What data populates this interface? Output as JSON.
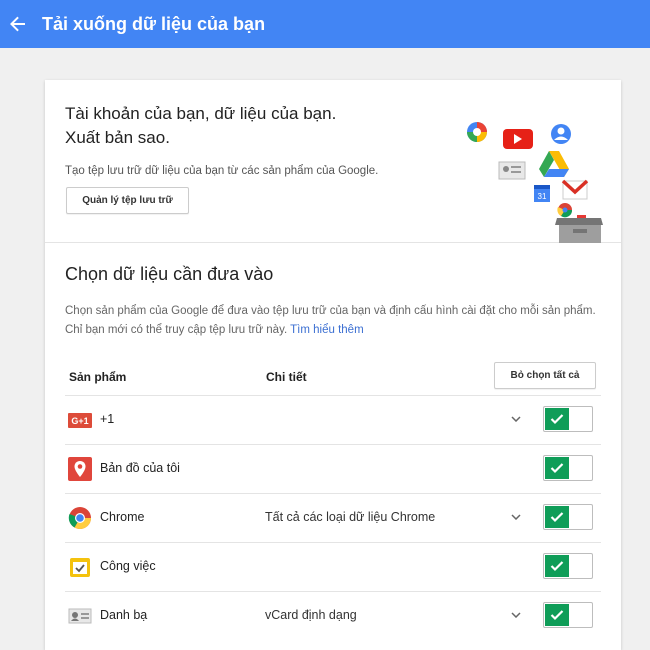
{
  "header": {
    "title": "Tải xuống dữ liệu của bạn"
  },
  "hero": {
    "heading_line1": "Tài khoản của bạn, dữ liệu của bạn.",
    "heading_line2": "Xuất bản sao.",
    "description": "Tạo tệp lưu trữ dữ liệu của bạn từ các sản phẩm của Google.",
    "manage_button": "Quản lý tệp lưu trữ",
    "illustration_icons": [
      "google-photos-icon",
      "youtube-icon",
      "contacts-icon",
      "drive-icon",
      "calendar-icon",
      "gmail-icon",
      "archive-box-icon"
    ]
  },
  "section": {
    "title": "Chọn dữ liệu cần đưa vào",
    "description": "Chọn sản phẩm của Google để đưa vào tệp lưu trữ của bạn và định cấu hình cài đặt cho mỗi sản phẩm. Chỉ bạn mới có thể truy cập tệp lưu trữ này.",
    "learn_more": "Tìm hiểu thêm"
  },
  "table": {
    "col_product": "Sản phẩm",
    "col_details": "Chi tiết",
    "deselect_all": "Bỏ chọn tất cả",
    "rows": [
      {
        "name": "+1",
        "detail": "",
        "icon": "gplus-icon",
        "has_chevron": true,
        "enabled": true
      },
      {
        "name": "Bản đồ của tôi",
        "detail": "",
        "icon": "maps-pin-icon",
        "has_chevron": false,
        "enabled": true
      },
      {
        "name": "Chrome",
        "detail": "Tất cả các loại dữ liệu Chrome",
        "icon": "chrome-icon",
        "has_chevron": true,
        "enabled": true
      },
      {
        "name": "Công việc",
        "detail": "",
        "icon": "tasks-icon",
        "has_chevron": false,
        "enabled": true
      },
      {
        "name": "Danh bạ",
        "detail": "vCard định dạng",
        "icon": "contacts-card-icon",
        "has_chevron": true,
        "enabled": true
      }
    ]
  },
  "colors": {
    "header": "#4285f4",
    "toggle_on": "#0f9d58",
    "link": "#3b6fd2"
  }
}
